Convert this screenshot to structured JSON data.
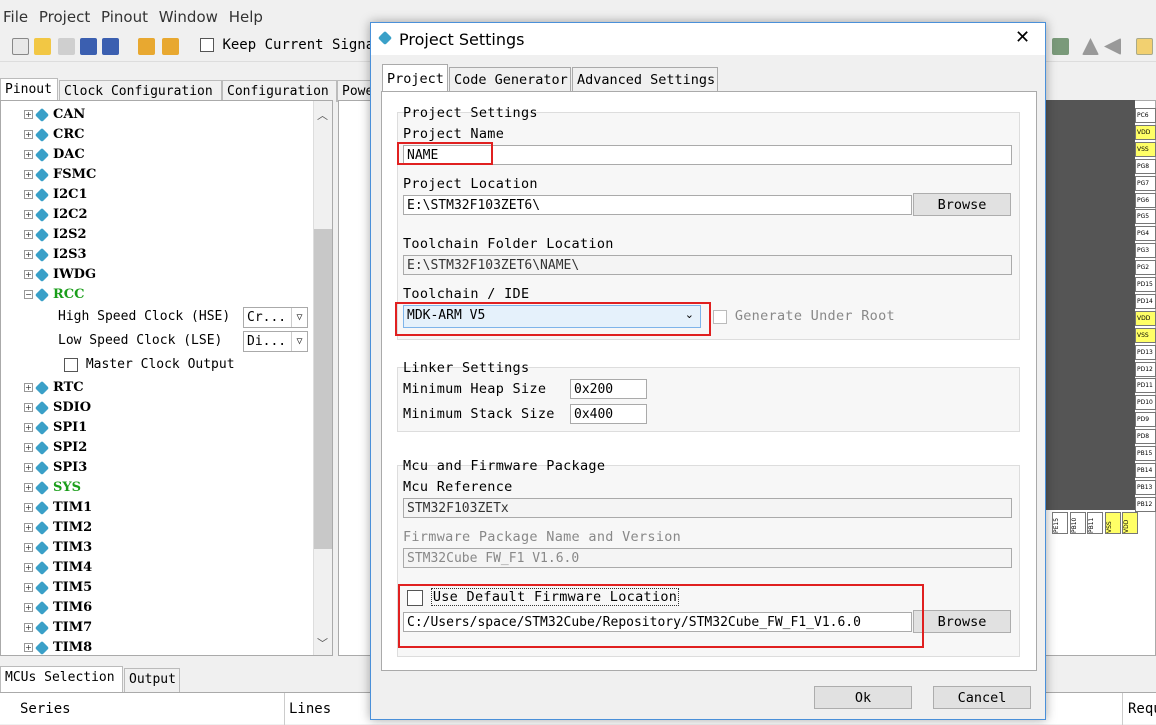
{
  "menu": [
    "File",
    "Project",
    "Pinout",
    "Window",
    "Help"
  ],
  "toolbar": {
    "keep_signal": "Keep Current Signal"
  },
  "left_tabs": [
    "Pinout",
    "Clock Configuration",
    "Configuration",
    "Powe"
  ],
  "tree": {
    "items_top": [
      "CAN",
      "CRC",
      "DAC",
      "FSMC",
      "I2C1",
      "I2C2",
      "I2S2",
      "I2S3",
      "IWDG",
      "RCC"
    ],
    "rcc_children": {
      "hse_label": "High Speed Clock (HSE)",
      "hse_value": "Cr...",
      "lse_label": "Low Speed Clock (LSE)",
      "lse_value": "Di...",
      "mco_label": "Master Clock Output"
    },
    "items_bottom": [
      "RTC",
      "SDIO",
      "SPI1",
      "SPI2",
      "SPI3",
      "SYS",
      "TIM1",
      "TIM2",
      "TIM3",
      "TIM4",
      "TIM5",
      "TIM6",
      "TIM7",
      "TIM8"
    ],
    "green_items": [
      "RCC",
      "SYS"
    ]
  },
  "pins_right": [
    "PC6",
    "VDD",
    "VSS",
    "PG8",
    "PG7",
    "PG6",
    "PG5",
    "PG4",
    "PG3",
    "PG2",
    "PD15",
    "PD14",
    "VDD",
    "VSS",
    "PD13",
    "PD12",
    "PD11",
    "PD10",
    "PD9",
    "PD8",
    "PB15",
    "PB14",
    "PB13",
    "PB12"
  ],
  "pins_bottom": [
    "PE15",
    "PB10",
    "PB11",
    "VSS",
    "VDD"
  ],
  "bottom_tabs": [
    "MCUs Selection",
    "Output"
  ],
  "bottom_columns": [
    "Series",
    "Lines",
    "Requ"
  ],
  "dialog": {
    "title": "Project Settings",
    "tabs": [
      "Project",
      "Code Generator",
      "Advanced Settings"
    ],
    "project_settings": {
      "group_title": "Project Settings",
      "name_label": "Project Name",
      "name_value": "NAME",
      "location_label": "Project Location",
      "location_value": "E:\\STM32F103ZET6\\",
      "browse": "Browse",
      "toolchain_folder_label": "Toolchain Folder Location",
      "toolchain_folder_value": "E:\\STM32F103ZET6\\NAME\\",
      "toolchain_ide_label": "Toolchain / IDE",
      "toolchain_ide_value": "MDK-ARM V5",
      "generate_under_root": "Generate Under Root"
    },
    "linker_settings": {
      "group_title": "Linker Settings",
      "heap_label": "Minimum Heap Size",
      "heap_value": "0x200",
      "stack_label": "Minimum Stack Size",
      "stack_value": "0x400"
    },
    "mcu_firmware": {
      "group_title": "Mcu and Firmware Package",
      "mcu_ref_label": "Mcu Reference",
      "mcu_ref_value": "STM32F103ZETx",
      "fw_label": "Firmware Package Name and Version",
      "fw_value": "STM32Cube FW_F1 V1.6.0",
      "use_default_label": "Use Default Firmware Location",
      "fw_path": "C:/Users/space/STM32Cube/Repository/STM32Cube_FW_F1_V1.6.0",
      "browse": "Browse"
    },
    "ok": "Ok",
    "cancel": "Cancel"
  },
  "colors": {
    "accent_green": "#1a9e1a",
    "highlight_red": "#e02020",
    "pin_yellow": "#ffff66",
    "dialog_border": "#4a90d9"
  }
}
